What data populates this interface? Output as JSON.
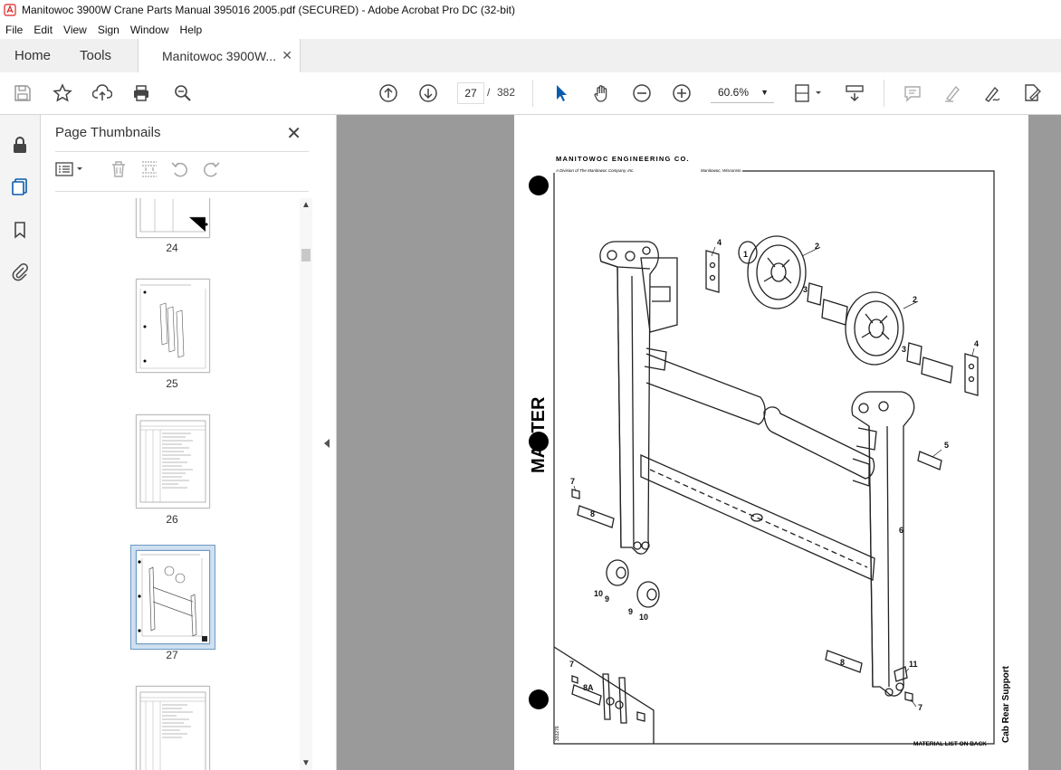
{
  "window": {
    "title": "Manitowoc 3900W Crane Parts Manual 395016 2005.pdf (SECURED) - Adobe Acrobat Pro DC (32-bit)"
  },
  "menu": [
    "File",
    "Edit",
    "View",
    "Sign",
    "Window",
    "Help"
  ],
  "tabs": {
    "home": "Home",
    "tools": "Tools",
    "doc": "Manitowoc 3900W..."
  },
  "toolbar": {
    "current_page": "27",
    "separator": "/",
    "page_count": "382",
    "zoom": "60.6%"
  },
  "panel": {
    "title": "Page Thumbnails",
    "thumbnails": [
      "24",
      "25",
      "26",
      "27"
    ]
  },
  "document": {
    "company": "MANITOWOC ENGINEERING CO.",
    "division": "A Division of The Manitowoc Company, Inc.",
    "location": "Manitowoc, Wisconsin",
    "stamp": "MASTER",
    "part_title": "Cab Rear Support",
    "footer": "MATERIAL LIST ON BACK",
    "drawing_number": "333276",
    "callouts": [
      "1",
      "2",
      "2",
      "3",
      "3",
      "4",
      "4",
      "5",
      "6",
      "7",
      "7",
      "7",
      "8",
      "8",
      "8A",
      "9",
      "9",
      "10",
      "10",
      "11"
    ]
  },
  "colors": {
    "accent": "#0b5cad",
    "selection": "#cfe0f0",
    "viewer_bg": "#9a9a9a"
  }
}
